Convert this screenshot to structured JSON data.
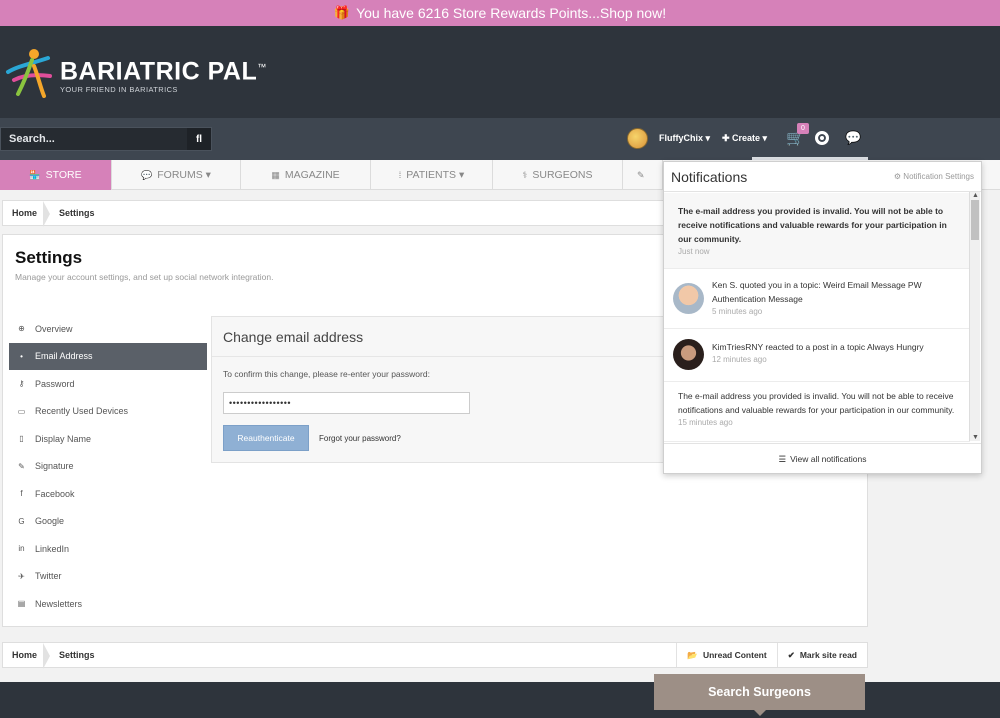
{
  "promo": {
    "icon": "gift-icon",
    "text": "You have 6216 Store Rewards Points...Shop now!"
  },
  "brand": {
    "name": "BARIATRIC PAL",
    "tm": "™",
    "tagline": "YOUR FRIEND IN BARIATRICS"
  },
  "userbar": {
    "search_placeholder": "Search...",
    "search_button_icon": "fl",
    "username": "FluffyChix ▾",
    "create": "✚ Create ▾",
    "cart_count": "0"
  },
  "nav": [
    {
      "label": "STORE",
      "icon": "🏪"
    },
    {
      "label": "FORUMS ▾",
      "icon": "💬"
    },
    {
      "label": "MAGAZINE",
      "icon": "▦"
    },
    {
      "label": "PATIENTS ▾",
      "icon": "⁞"
    },
    {
      "label": "SURGEONS",
      "icon": "⚕"
    },
    {
      "label": "",
      "icon": "✎"
    }
  ],
  "breadcrumb": {
    "home": "Home",
    "current": "Settings"
  },
  "crumb_actions": {
    "unread": "Unread Content",
    "mark_read": "Mark site read"
  },
  "page": {
    "title": "Settings",
    "description": "Manage your account settings, and set up social network integration."
  },
  "side_menu": [
    {
      "label": "Overview",
      "icon": "⊕"
    },
    {
      "label": "Email Address",
      "icon": "•"
    },
    {
      "label": "Password",
      "icon": "⚷"
    },
    {
      "label": "Recently Used Devices",
      "icon": "▭"
    },
    {
      "label": "Display Name",
      "icon": "▯"
    },
    {
      "label": "Signature",
      "icon": "✎"
    },
    {
      "label": "Facebook",
      "icon": "f"
    },
    {
      "label": "Google",
      "icon": "G"
    },
    {
      "label": "LinkedIn",
      "icon": "in"
    },
    {
      "label": "Twitter",
      "icon": "✈"
    },
    {
      "label": "Newsletters",
      "icon": "▤"
    }
  ],
  "email_form": {
    "title": "Change email address",
    "label": "To confirm this change, please re-enter your password:",
    "password_value": "•••••••••••••••••",
    "reauth_button": "Reauthenticate",
    "forgot_link": "Forgot your password?"
  },
  "notifications": {
    "title": "Notifications",
    "settings_link": "⚙ Notification Settings",
    "items": [
      {
        "text": "The e-mail address you provided is invalid. You will not be able to receive notifications and valuable rewards for your participation in our community.",
        "time": "Just now"
      },
      {
        "text": "Ken S. quoted you in a topic: Weird Email Message PW Authentication Message",
        "time": "5 minutes ago"
      },
      {
        "text": "KimTriesRNY reacted to a post in a topic Always Hungry",
        "time": "12 minutes ago"
      },
      {
        "text": "The e-mail address you provided is invalid. You will not be able to receive notifications and valuable rewards for your participation in our community.",
        "time": "15 minutes ago"
      }
    ],
    "view_all": "View all notifications"
  },
  "footer": {
    "search_surgeons": "Search Surgeons"
  },
  "colors": {
    "brand_pink": "#d681b9",
    "header_dark": "#2e343c",
    "reauth_blue": "#8fb0d4"
  }
}
